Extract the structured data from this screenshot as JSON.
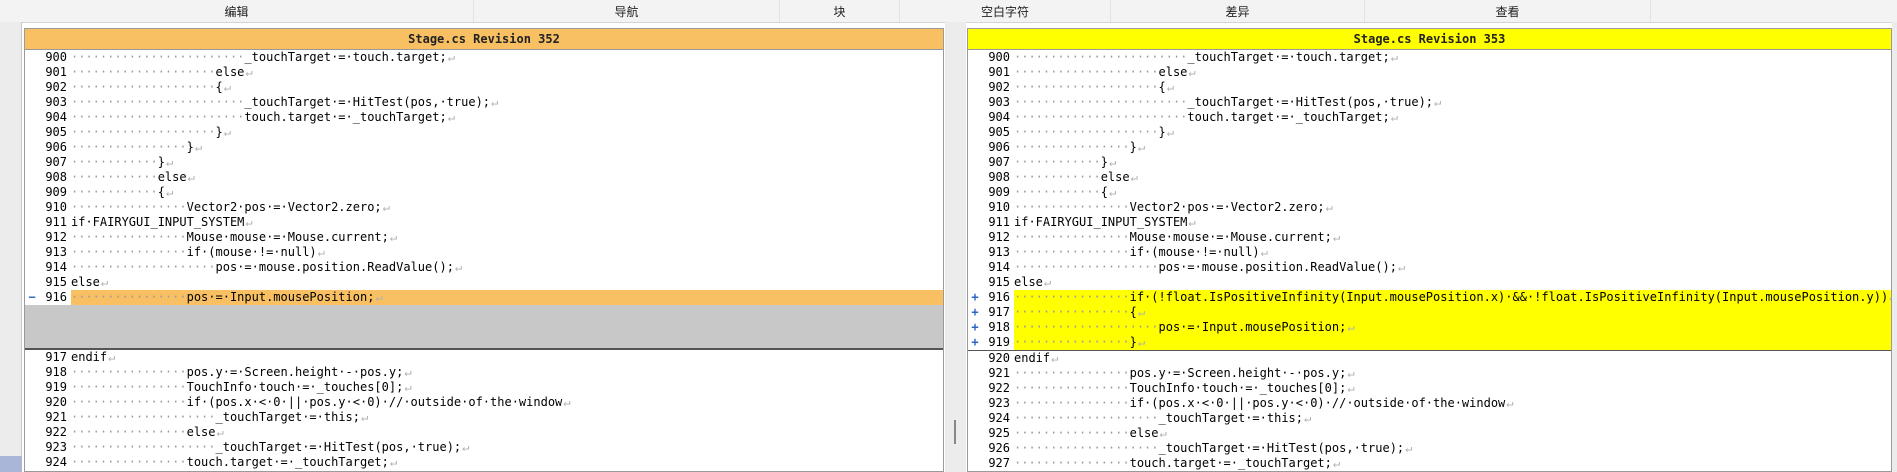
{
  "menu": {
    "items": [
      {
        "name": "menu-edit",
        "label": "编辑"
      },
      {
        "name": "menu-navigate",
        "label": "导航"
      },
      {
        "name": "menu-block",
        "label": "块"
      },
      {
        "name": "menu-whitespace",
        "label": "空白字符"
      },
      {
        "name": "menu-diff",
        "label": "差异"
      },
      {
        "name": "menu-view",
        "label": "查看"
      }
    ]
  },
  "left_pane": {
    "title": "Stage.cs Revision 352",
    "before": [
      {
        "n": "900",
        "i": 24,
        "t": "_touchTarget = touch.target;"
      },
      {
        "n": "901",
        "i": 20,
        "t": "else"
      },
      {
        "n": "902",
        "i": 20,
        "t": "{"
      },
      {
        "n": "903",
        "i": 24,
        "t": "_touchTarget = HitTest(pos, true);"
      },
      {
        "n": "904",
        "i": 24,
        "t": "touch.target = _touchTarget;"
      },
      {
        "n": "905",
        "i": 20,
        "t": "}"
      },
      {
        "n": "906",
        "i": 16,
        "t": "}"
      },
      {
        "n": "907",
        "i": 12,
        "t": "}"
      },
      {
        "n": "908",
        "i": 12,
        "t": "else"
      },
      {
        "n": "909",
        "i": 12,
        "t": "{"
      },
      {
        "n": "910",
        "i": 16,
        "t": "Vector2 pos = Vector2.zero;"
      },
      {
        "n": "911",
        "i": 0,
        "t": "if FAIRYGUI_INPUT_SYSTEM"
      },
      {
        "n": "912",
        "i": 16,
        "t": "Mouse mouse = Mouse.current;"
      },
      {
        "n": "913",
        "i": 16,
        "t": "if (mouse != null)"
      },
      {
        "n": "914",
        "i": 20,
        "t": "pos = mouse.position.ReadValue();"
      },
      {
        "n": "915",
        "i": 0,
        "t": "else"
      }
    ],
    "changed": [
      {
        "n": "916",
        "m": "−",
        "i": 16,
        "t": "pos = Input.mousePosition;"
      }
    ],
    "after": [
      {
        "n": "917",
        "i": 0,
        "t": "endif"
      },
      {
        "n": "918",
        "i": 16,
        "t": "pos.y = Screen.height - pos.y;"
      },
      {
        "n": "919",
        "i": 16,
        "t": "TouchInfo touch = _touches[0];"
      },
      {
        "n": "920",
        "i": 16,
        "t": "if (pos.x < 0 || pos.y < 0) // outside of the window"
      },
      {
        "n": "921",
        "i": 20,
        "t": "_touchTarget = this;"
      },
      {
        "n": "922",
        "i": 16,
        "t": "else"
      },
      {
        "n": "923",
        "i": 20,
        "t": "_touchTarget = HitTest(pos, true);"
      },
      {
        "n": "924",
        "i": 16,
        "t": "touch.target = _touchTarget;"
      }
    ]
  },
  "right_pane": {
    "title": "Stage.cs Revision 353",
    "before": [
      {
        "n": "900",
        "i": 24,
        "t": "_touchTarget = touch.target;"
      },
      {
        "n": "901",
        "i": 20,
        "t": "else"
      },
      {
        "n": "902",
        "i": 20,
        "t": "{"
      },
      {
        "n": "903",
        "i": 24,
        "t": "_touchTarget = HitTest(pos, true);"
      },
      {
        "n": "904",
        "i": 24,
        "t": "touch.target = _touchTarget;"
      },
      {
        "n": "905",
        "i": 20,
        "t": "}"
      },
      {
        "n": "906",
        "i": 16,
        "t": "}"
      },
      {
        "n": "907",
        "i": 12,
        "t": "}"
      },
      {
        "n": "908",
        "i": 12,
        "t": "else"
      },
      {
        "n": "909",
        "i": 12,
        "t": "{"
      },
      {
        "n": "910",
        "i": 16,
        "t": "Vector2 pos = Vector2.zero;"
      },
      {
        "n": "911",
        "i": 0,
        "t": "if FAIRYGUI_INPUT_SYSTEM"
      },
      {
        "n": "912",
        "i": 16,
        "t": "Mouse mouse = Mouse.current;"
      },
      {
        "n": "913",
        "i": 16,
        "t": "if (mouse != null)"
      },
      {
        "n": "914",
        "i": 20,
        "t": "pos = mouse.position.ReadValue();"
      },
      {
        "n": "915",
        "i": 0,
        "t": "else"
      }
    ],
    "changed": [
      {
        "n": "916",
        "m": "+",
        "i": 16,
        "t": "if (!float.IsPositiveInfinity(Input.mousePosition.x) && !float.IsPositiveInfinity(Input.mousePosition.y))"
      },
      {
        "n": "917",
        "m": "+",
        "i": 16,
        "t": "{"
      },
      {
        "n": "918",
        "m": "+",
        "i": 20,
        "t": "pos = Input.mousePosition;"
      },
      {
        "n": "919",
        "m": "+",
        "i": 16,
        "t": "}"
      }
    ],
    "after": [
      {
        "n": "920",
        "i": 0,
        "t": "endif"
      },
      {
        "n": "921",
        "i": 16,
        "t": "pos.y = Screen.height - pos.y;"
      },
      {
        "n": "922",
        "i": 16,
        "t": "TouchInfo touch = _touches[0];"
      },
      {
        "n": "923",
        "i": 16,
        "t": "if (pos.x < 0 || pos.y < 0) // outside of the window"
      },
      {
        "n": "924",
        "i": 20,
        "t": "_touchTarget = this;"
      },
      {
        "n": "925",
        "i": 16,
        "t": "else"
      },
      {
        "n": "926",
        "i": 20,
        "t": "_touchTarget = HitTest(pos, true);"
      },
      {
        "n": "927",
        "i": 16,
        "t": "touch.target = _touchTarget;"
      }
    ]
  },
  "symbols": {
    "space_dot": "·",
    "eol": "↵"
  },
  "colors": {
    "removed_bg": "#f8c063",
    "added_bg": "#ffff00",
    "marker": "#2b64c4"
  }
}
